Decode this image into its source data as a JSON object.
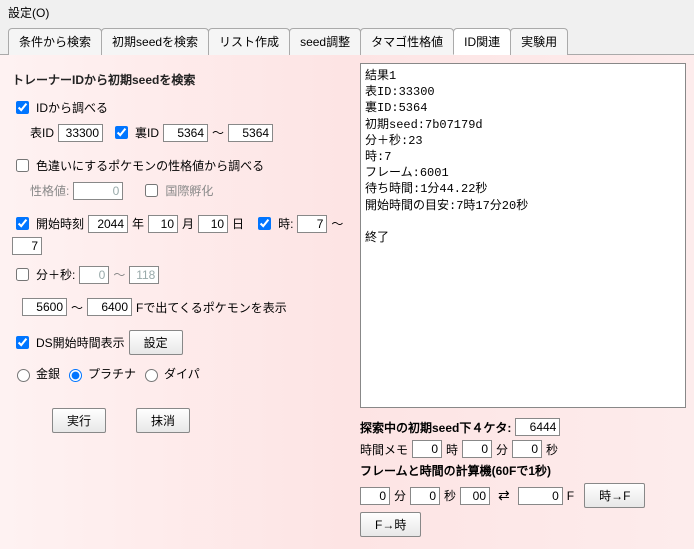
{
  "menubar": {
    "settings": "設定(O)"
  },
  "tabs": [
    {
      "label": "条件から検索"
    },
    {
      "label": "初期seedを検索"
    },
    {
      "label": "リスト作成"
    },
    {
      "label": "seed調整"
    },
    {
      "label": "タマゴ性格値"
    },
    {
      "label": "ID関連"
    },
    {
      "label": "実験用"
    }
  ],
  "activeTab": 5,
  "left": {
    "title": "トレーナーIDから初期seedを検索",
    "searchById": {
      "label": "IDから調べる",
      "checked": true
    },
    "omoteId": {
      "label": "表ID",
      "value": "33300"
    },
    "uraCheck": {
      "label": "裏ID",
      "checked": true
    },
    "uraFrom": "5364",
    "uraTo": "5364",
    "tilde": "～",
    "irochigai": {
      "label": "色違いにするポケモンの性格値から調べる",
      "checked": false
    },
    "seikaku": {
      "label": "性格値:",
      "value": "0"
    },
    "kokusai": {
      "label": "国際孵化",
      "checked": false
    },
    "kaishi": {
      "label": "開始時刻",
      "checked": true
    },
    "year": "2044",
    "yearSuffix": "年",
    "month": "10",
    "monthSuffix": "月",
    "day": "10",
    "daySuffix": "日",
    "jiCheck": {
      "label": "時:",
      "checked": true
    },
    "jiFrom": "7",
    "jiTo": "7",
    "funbyou": {
      "label": "分＋秒:",
      "checked": false,
      "from": "0",
      "to": "118"
    },
    "frameFrom": "5600",
    "frameTo": "6400",
    "frameSuffix": "Fで出てくるポケモンを表示",
    "dsStart": {
      "label": "DS開始時間表示",
      "checked": true
    },
    "setteiBtn": "設定",
    "version": {
      "kingin": "金銀",
      "platinum": "プラチナ",
      "daipa": "ダイパ",
      "selected": "platinum"
    },
    "execute": "実行",
    "clear": "抹消"
  },
  "right": {
    "resultsText": "結果1\n表ID:33300\n裏ID:5364\n初期seed:7b07179d\n分＋秒:23\n時:7\nフレーム:6001\n待ち時間:1分44.22秒\n開始時間の目安:7時17分20秒\n\n終了",
    "tansaku": {
      "label": "探索中の初期seed下４ケタ:",
      "value": "6444"
    },
    "jikanMemo": {
      "label": "時間メモ",
      "ji": "0",
      "jiSuf": "時",
      "fun": "0",
      "funSuf": "分",
      "byou": "0",
      "byouSuf": "秒"
    },
    "calcTitle": "フレームと時間の計算機(60Fで1秒)",
    "calc": {
      "fun": "0",
      "funSuf": "分",
      "byou": "0",
      "byouSuf": "秒",
      "sub": "00",
      "frame": "0",
      "fsuf": "F"
    },
    "jiToF": "時→F",
    "fToJi": "F→時",
    "swap": "⇄"
  }
}
